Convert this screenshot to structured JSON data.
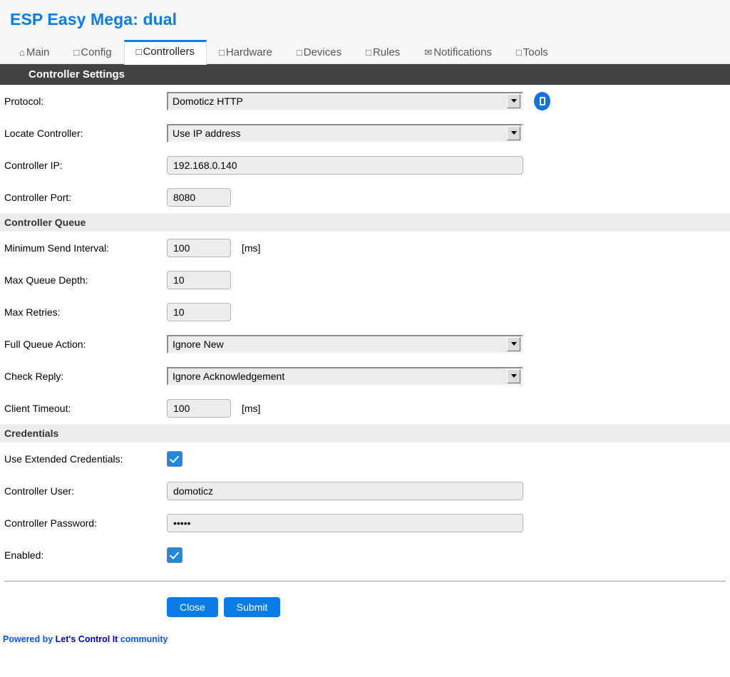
{
  "header": {
    "title": "ESP Easy Mega: dual",
    "tabs": [
      {
        "icon": "home-icon",
        "glyph": "⌂",
        "label": "Main",
        "active": false
      },
      {
        "icon": "config-box-icon",
        "glyph": "□",
        "label": "Config",
        "active": false
      },
      {
        "icon": "controllers-box-icon",
        "glyph": "□",
        "label": "Controllers",
        "active": true
      },
      {
        "icon": "hardware-box-icon",
        "glyph": "□",
        "label": "Hardware",
        "active": false
      },
      {
        "icon": "devices-box-icon",
        "glyph": "□",
        "label": "Devices",
        "active": false
      },
      {
        "icon": "rules-box-icon",
        "glyph": "□",
        "label": "Rules",
        "active": false
      },
      {
        "icon": "envelope-icon",
        "glyph": "✉",
        "label": "Notifications",
        "active": false
      },
      {
        "icon": "tools-box-icon",
        "glyph": "□",
        "label": "Tools",
        "active": false
      }
    ]
  },
  "sections": {
    "controller_settings": {
      "title": "Controller Settings",
      "protocol": {
        "label": "Protocol:",
        "value": "Domoticz HTTP",
        "info_button_icon": "document-icon"
      },
      "locate_controller": {
        "label": "Locate Controller:",
        "value": "Use IP address"
      },
      "controller_ip": {
        "label": "Controller IP:",
        "value": "192.168.0.140"
      },
      "controller_port": {
        "label": "Controller Port:",
        "value": "8080"
      }
    },
    "controller_queue": {
      "title": "Controller Queue",
      "min_send_interval": {
        "label": "Minimum Send Interval:",
        "value": "100",
        "unit": "[ms]"
      },
      "max_queue_depth": {
        "label": "Max Queue Depth:",
        "value": "10"
      },
      "max_retries": {
        "label": "Max Retries:",
        "value": "10"
      },
      "full_queue_action": {
        "label": "Full Queue Action:",
        "value": "Ignore New"
      },
      "check_reply": {
        "label": "Check Reply:",
        "value": "Ignore Acknowledgement"
      },
      "client_timeout": {
        "label": "Client Timeout:",
        "value": "100",
        "unit": "[ms]"
      }
    },
    "credentials": {
      "title": "Credentials",
      "use_extended_credentials": {
        "label": "Use Extended Credentials:",
        "checked": true
      },
      "controller_user": {
        "label": "Controller User:",
        "value": "domoticz"
      },
      "controller_password": {
        "label": "Controller Password:",
        "value": "•••••"
      },
      "enabled": {
        "label": "Enabled:",
        "checked": true
      }
    }
  },
  "footer": {
    "close_label": "Close",
    "submit_label": "Submit",
    "powered_prefix": "Powered by ",
    "powered_brand": "Let's Control It",
    "powered_suffix": " community"
  },
  "colors": {
    "accent_blue": "#0a7ce8",
    "dark_header": "#434343",
    "section_band": "#ececec",
    "input_bg": "#ececec",
    "brand_blue": "#0000cc"
  }
}
